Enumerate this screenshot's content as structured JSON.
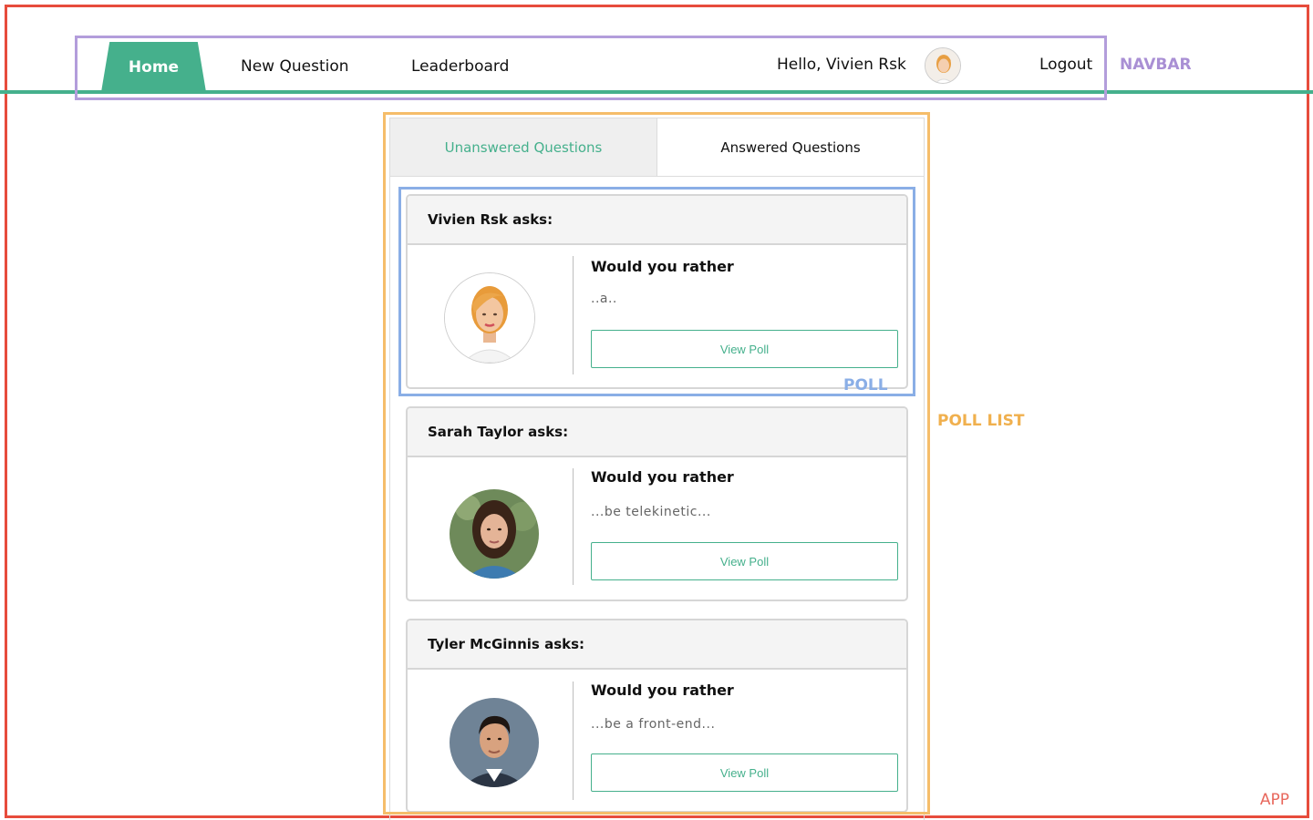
{
  "navbar": {
    "home": "Home",
    "new_question": "New Question",
    "leaderboard": "Leaderboard",
    "greeting": "Hello, Vivien Rsk",
    "logout": "Logout"
  },
  "annotations": {
    "app": "APP",
    "navbar": "NAVBAR",
    "poll_list": "POLL LIST",
    "poll": "POLL"
  },
  "tabs": {
    "unanswered": "Unanswered Questions",
    "answered": "Answered Questions"
  },
  "polls": [
    {
      "asker": "Vivien Rsk asks:",
      "heading": "Would you rather",
      "snippet": "..a..",
      "button": "View Poll"
    },
    {
      "asker": "Sarah Taylor asks:",
      "heading": "Would you rather",
      "snippet": "...be telekinetic...",
      "button": "View Poll"
    },
    {
      "asker": "Tyler McGinnis asks:",
      "heading": "Would you rather",
      "snippet": "...be a front-end...",
      "button": "View Poll"
    }
  ],
  "colors": {
    "accent": "#45b08c",
    "app_annotation": "#e74c3c",
    "navbar_annotation": "#b39ddb",
    "poll_list_annotation": "#f5bd6a",
    "poll_annotation": "#8aaee6"
  },
  "icons": [
    "avatar-vivien",
    "avatar-sarah",
    "avatar-tyler"
  ]
}
